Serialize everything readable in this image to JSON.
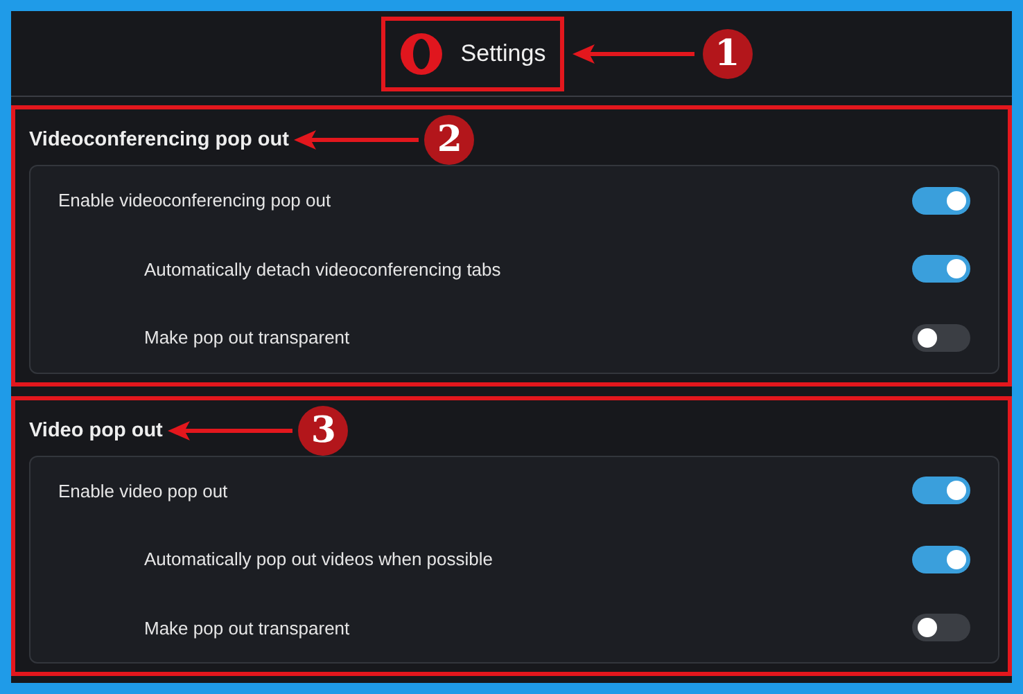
{
  "header": {
    "title": "Settings",
    "callout": "1"
  },
  "sections": [
    {
      "title": "Videoconferencing pop out",
      "callout": "2",
      "settings": [
        {
          "label": "Enable videoconferencing pop out",
          "on": true,
          "children": [
            {
              "label": "Automatically detach videoconferencing tabs",
              "on": true
            },
            {
              "label": "Make pop out transparent",
              "on": false
            }
          ]
        }
      ]
    },
    {
      "title": "Video pop out",
      "callout": "3",
      "settings": [
        {
          "label": "Enable video pop out",
          "on": true,
          "children": [
            {
              "label": "Automatically pop out videos when possible",
              "on": true
            },
            {
              "label": "Make pop out transparent",
              "on": false
            }
          ]
        }
      ]
    }
  ]
}
